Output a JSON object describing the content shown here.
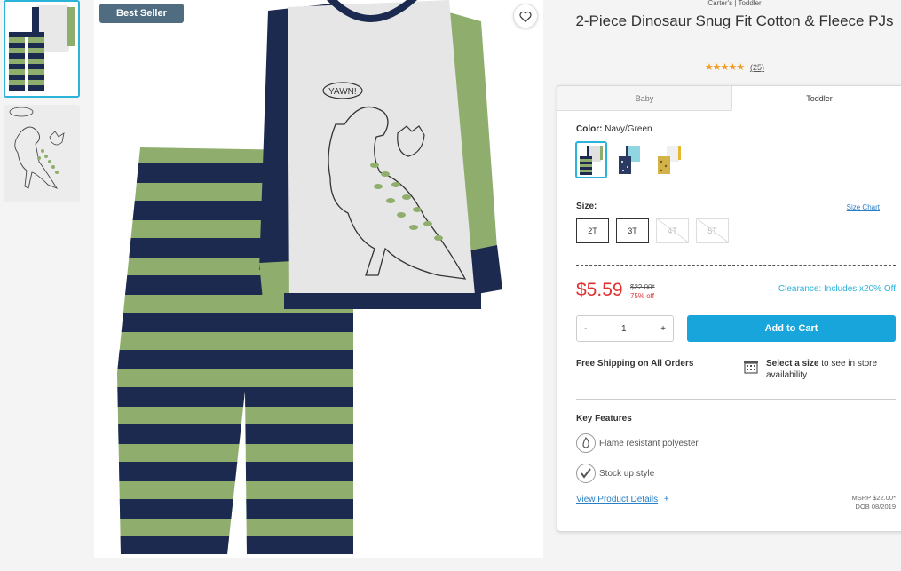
{
  "badge": "Best Seller",
  "product": {
    "brand_line": "Carter's | Toddler",
    "title": "2-Piece Dinosaur Snug Fit Cotton & Fleece PJs",
    "stars": "★★★★★",
    "reviews": "(25)"
  },
  "tabs": [
    {
      "label": "Baby"
    },
    {
      "label": "Toddler"
    }
  ],
  "color": {
    "label": "Color:",
    "value": "Navy/Green"
  },
  "size": {
    "label": "Size:",
    "chart_link": "Size Chart",
    "options": [
      {
        "label": "2T"
      },
      {
        "label": "3T"
      },
      {
        "label": "4T"
      },
      {
        "label": "5T"
      }
    ]
  },
  "pricing": {
    "price": "$5.59",
    "was": "$22.00*",
    "percent_off": "75% off",
    "clearance": "Clearance: Includes x20% Off"
  },
  "quantity": {
    "minus": "-",
    "value": "1",
    "plus": "+"
  },
  "add_to_cart": "Add to Cart",
  "shipping": "Free Shipping on All Orders",
  "store": {
    "bold": "Select a size",
    "rest": " to see in store availability"
  },
  "key_features": {
    "heading": "Key Features",
    "items": [
      {
        "label": "Flame resistant polyester"
      },
      {
        "label": "Stock up style"
      }
    ]
  },
  "details": {
    "link": "View Product Details",
    "plus": "+"
  },
  "msrp": {
    "line1": "MSRP $22.00*",
    "line2": "DOB 08/2019"
  },
  "colors": {
    "accent": "#18a5dc",
    "price_red": "#e03131",
    "badge": "#4f6c80",
    "star": "#f19c1f",
    "navy": "#1b2a4e",
    "green": "#8fae6d"
  }
}
